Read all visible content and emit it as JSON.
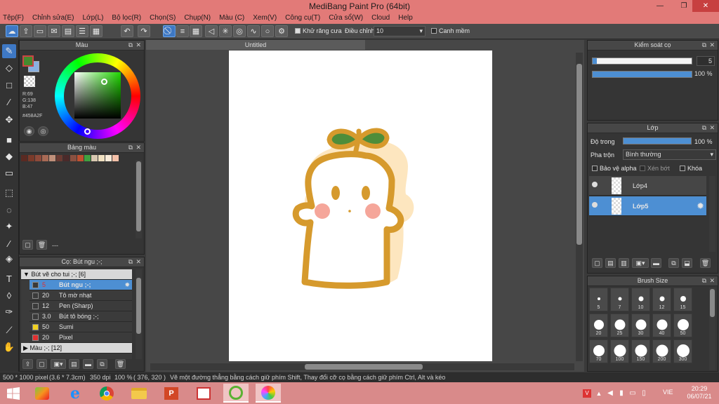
{
  "window": {
    "title": "MediBang Paint Pro (64bit)",
    "minimize": "—",
    "maximize": "❐",
    "close": "✕"
  },
  "menu": [
    "Tệp(F)",
    "Chỉnh sửa(E)",
    "Lớp(L)",
    "Bộ lọc(R)",
    "Chọn(S)",
    "Chụp(N)",
    "Màu (C)",
    "Xem(V)",
    "Công cụ(T)",
    "Cửa sổ(W)",
    "Cloud",
    "Help"
  ],
  "toolbar": {
    "antialias_label": "Khử răng cưa",
    "antialias_checked": true,
    "correction_label": "Điều chỉnh",
    "correction_value": "10",
    "snap_label": "Canh mềm",
    "snap_checked": false
  },
  "color_panel": {
    "title": "Màu",
    "main_color": "#458A2F",
    "r": "R:69",
    "g": "G:138",
    "b": "B:47",
    "hex": "#458A2F"
  },
  "palette_panel": {
    "title": "Bảng màu",
    "swatches": [
      "#5a2a22",
      "#7a3a2a",
      "#8e4a3a",
      "#a86a55",
      "#c0907a",
      "#6a3a32",
      "#4a2a2a",
      "#8a5040",
      "#c05030",
      "#40a040",
      "#d8c8b0",
      "#f0e0c0",
      "#f8ead8",
      "#f4c0a8"
    ],
    "footer_text": "---"
  },
  "brush_panel": {
    "title": "Cọ: Bút ngu ;-;",
    "group1": "Bút vẽ cho tui ;-; [6]",
    "brushes": [
      {
        "size": "5",
        "name": "Bút ngu ;-;",
        "color": "#3a3a3a"
      },
      {
        "size": "20",
        "name": "Tô mờ nhạt",
        "color": "#3a3a3a"
      },
      {
        "size": "12",
        "name": "Pen (Sharp)",
        "color": "#3a3a3a"
      },
      {
        "size": "3.0",
        "name": "Bút tô bóng ;-;",
        "color": "#3a3a3a"
      },
      {
        "size": "50",
        "name": "Sumi",
        "color": "#f0d020"
      },
      {
        "size": "20",
        "name": "Pixel",
        "color": "#e03030"
      }
    ],
    "group2": "Màu ;-; [12]"
  },
  "canvas": {
    "tab": "Untitled"
  },
  "brush_control": {
    "title": "Kiểm soát cọ",
    "size": "5",
    "size_fraction": 0.04,
    "opacity": "100 %",
    "opacity_fraction": 1.0
  },
  "layer_panel": {
    "title": "Lớp",
    "opacity_label": "Độ trong",
    "opacity_value": "100 %",
    "blend_label": "Pha trộn",
    "blend_value": "Bình thường",
    "protect_alpha": "Bảo vệ alpha",
    "clipping": "Xén bớt",
    "lock": "Khóa",
    "layers": [
      {
        "name": "Lớp4",
        "selected": false
      },
      {
        "name": "Lớp5",
        "selected": true
      }
    ]
  },
  "brush_size_panel": {
    "title": "Brush Size",
    "sizes": [
      "5",
      "7",
      "10",
      "12",
      "15",
      "20",
      "25",
      "30",
      "40",
      "50",
      "70",
      "100",
      "150",
      "200",
      "300"
    ]
  },
  "status": {
    "size": "500 * 1000 pixel",
    "dims": "(3.6 * 7.3cm)",
    "dpi": "350 dpi",
    "zoom": "100 %",
    "coords": "( 376, 320 )",
    "hint": "Vẽ một đường thẳng bằng cách giữ phím Shift, Thay đổi cỡ cọ bằng cách giữ phím Ctrl, Alt và kéo"
  },
  "taskbar": {
    "lang": "VIE",
    "time": "20:29",
    "date": "06/07/21"
  }
}
